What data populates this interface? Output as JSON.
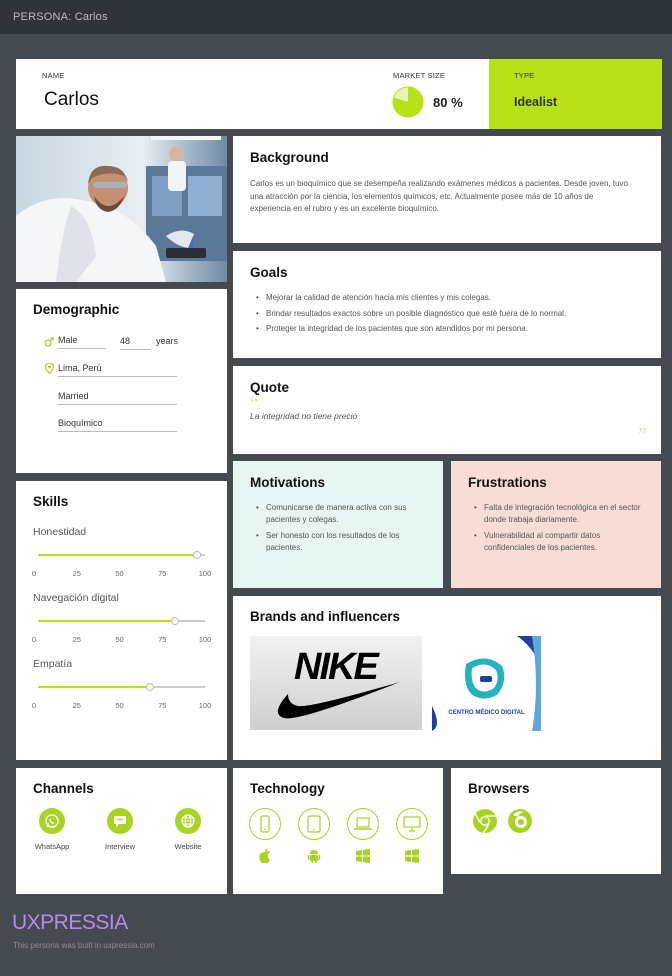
{
  "topbar": {
    "title": "PERSONA: Carlos"
  },
  "header": {
    "name_label": "NAME",
    "name": "Carlos",
    "market_label": "MARKET SIZE",
    "market_value": "80 %",
    "market_fraction": 0.8,
    "type_label": "TYPE",
    "type": "Idealist"
  },
  "background": {
    "title": "Background",
    "text": "Carlos es un bioquímico que se desempeña realizando exámenes médicos a pacientes. Desde joven, tuvo una atracción por la ciencia, los elementos químicos, etc. Actualmente posee más de 10 años de experiencia en el rubro y es un excelente bioquímico."
  },
  "goals": {
    "title": "Goals",
    "items": [
      "Mejorar la calidad de atención hacia mis clientes y mis colegas.",
      "Brindar resultados exactos sobre un posible diagnóstico que esté fuera de lo normal.",
      "Proteger la integridad de los pacientes que son atendidos por mi persona."
    ]
  },
  "quote": {
    "title": "Quote",
    "open_mark": "“",
    "text": "La integridad no tiene precio",
    "close_mark": "”"
  },
  "demographic": {
    "title": "Demographic",
    "gender": "Male",
    "age": "48",
    "age_unit": "years",
    "location": "Lima, Perú",
    "status": "Married",
    "occupation": "Bioquímico"
  },
  "skills": {
    "title": "Skills",
    "ticks": [
      "0",
      "25",
      "50",
      "75",
      "100"
    ],
    "items": [
      {
        "name": "Honestidad",
        "value": 95
      },
      {
        "name": "Navegación digital",
        "value": 82
      },
      {
        "name": "Empatía",
        "value": 67
      }
    ]
  },
  "motivations": {
    "title": "Motivations",
    "items": [
      "Comunicarse de manera activa con sus pacientes y colegas.",
      "Ser honesto con los resultados de los pacientes."
    ]
  },
  "frustrations": {
    "title": "Frustrations",
    "items": [
      "Falta de integración tecnológica en el sector donde trabaja diariamente.",
      "Vulnerabilidad al compartir datos confidenciales de los pacientes."
    ]
  },
  "brands": {
    "title": "Brands and influencers",
    "nike": "NIKE",
    "clinic_name": "CENTRO MÉDICO DIGITAL"
  },
  "channels": {
    "title": "Channels",
    "items": [
      {
        "label": "WhatsApp",
        "icon": "whatsapp-icon"
      },
      {
        "label": "Interview",
        "icon": "chat-icon"
      },
      {
        "label": "Website",
        "icon": "globe-icon"
      }
    ]
  },
  "technology": {
    "title": "Technology",
    "devices": [
      "smartphone-icon",
      "tablet-icon",
      "laptop-icon",
      "monitor-icon"
    ],
    "os": [
      "apple-icon",
      "android-icon",
      "windows-icon",
      "windows-icon"
    ]
  },
  "browsers": {
    "title": "Browsers",
    "items": [
      "chrome-icon",
      "firefox-icon"
    ]
  },
  "footer": {
    "brand": "UXPRESSIA",
    "note": "This persona was built in uxpressia.com"
  },
  "colors": {
    "accent": "#b9e11a",
    "background": "#454950",
    "motivations_bg": "#e7f6f2",
    "frustrations_bg": "#f8dcd6",
    "brand_purple": "#b28cf0"
  }
}
